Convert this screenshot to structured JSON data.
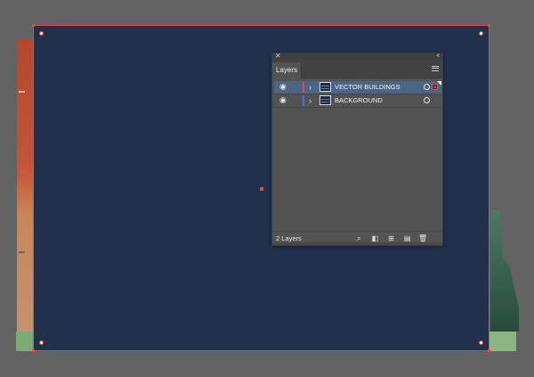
{
  "panel": {
    "tab_label": "Layers",
    "layers": [
      {
        "name": "VECTOR BUILDINGS",
        "color": "#e5494f",
        "selected": true
      },
      {
        "name": "BACKGROUND",
        "color": "#4a6df0",
        "selected": false
      }
    ],
    "layer_count": "2 Layers"
  },
  "icons": {
    "close": "✕",
    "collapse": "‹‹",
    "eye": "◉",
    "chevron": "›",
    "search": "⌕",
    "clip": "◧",
    "sublayer": "⊞",
    "new_layer": "▤",
    "trash": "🗑"
  },
  "colors": {
    "artboard": "#21314c",
    "selection": "#e5494f",
    "panel": "#535353"
  }
}
